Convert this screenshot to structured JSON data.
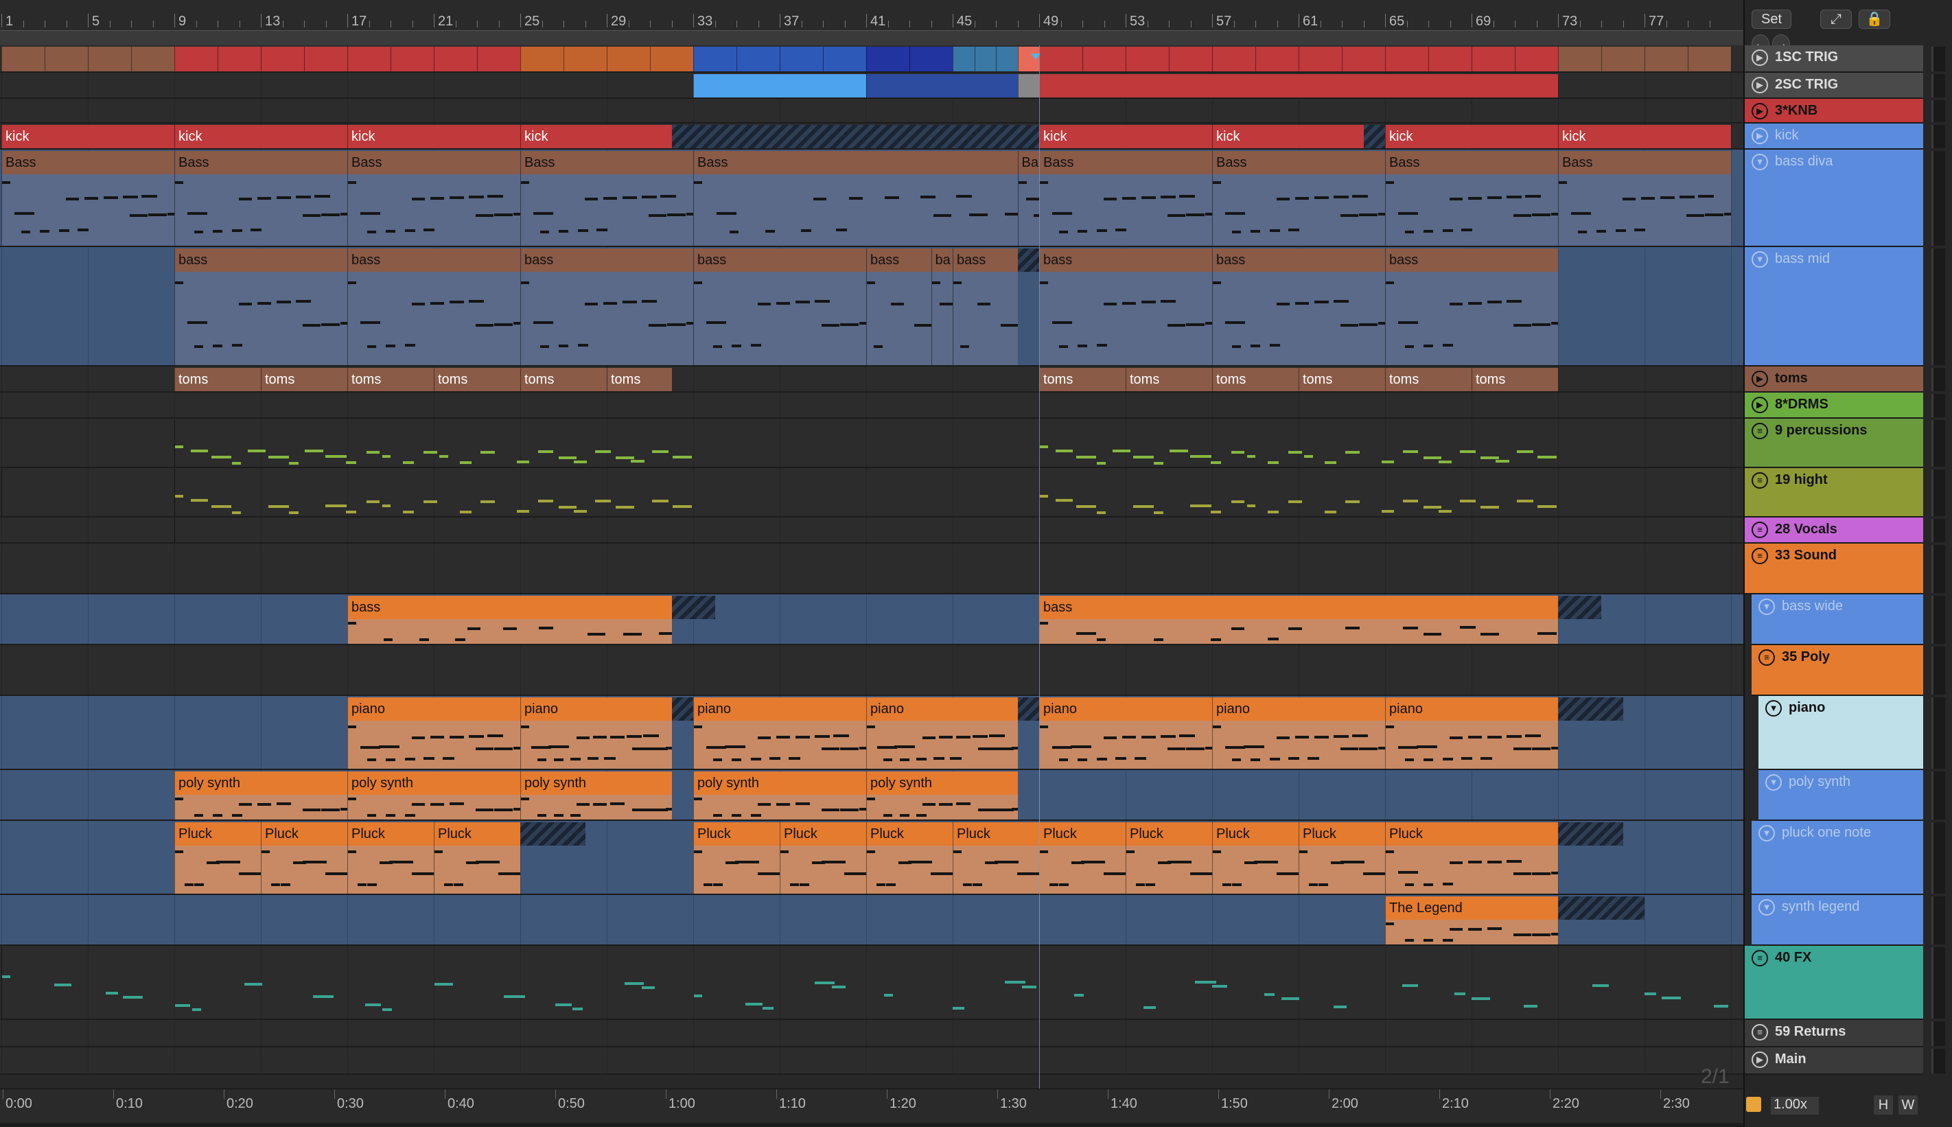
{
  "ruler": {
    "bars": [
      "1",
      "5",
      "9",
      "13",
      "17",
      "21",
      "25",
      "29",
      "33",
      "37",
      "41",
      "45",
      "49",
      "53",
      "57",
      "61",
      "65",
      "69",
      "73",
      "77"
    ]
  },
  "top_controls": {
    "set_label": "Set",
    "expand_icon": "expand-icon",
    "lock_icon": "lock-icon",
    "back_icon": "arrow-left-icon",
    "forward_icon": "arrow-right-icon"
  },
  "tracks": [
    {
      "name": "1SC TRIG",
      "color": "#4a4a4a",
      "icon": "play-icon"
    },
    {
      "name": "2SC TRIG",
      "color": "#4a4a4a",
      "icon": "play-icon"
    },
    {
      "name": "3*KNB",
      "color": "#c0393b",
      "icon": "play-icon"
    },
    {
      "name": "kick",
      "color": "#5b8bdc",
      "icon": "play-icon"
    },
    {
      "name": "bass diva",
      "color": "#5b8bdc",
      "icon": "chevron-down-icon"
    },
    {
      "name": "bass mid",
      "color": "#5b8bdc",
      "icon": "chevron-down-icon"
    },
    {
      "name": "toms",
      "color": "#8a5b47",
      "icon": "play-icon"
    },
    {
      "name": "8*DRMS",
      "color": "#6cad3f",
      "icon": "play-icon"
    },
    {
      "name": "9 percussions",
      "color": "#6a9a3c",
      "icon": "group-icon"
    },
    {
      "name": "19 hight",
      "color": "#8e9a33",
      "icon": "group-icon"
    },
    {
      "name": "28 Vocals",
      "color": "#c665d6",
      "icon": "group-icon"
    },
    {
      "name": "33 Sound",
      "color": "#e57b2f",
      "icon": "group-icon"
    },
    {
      "name": "bass wide",
      "color": "#5b8bdc",
      "icon": "chevron-down-icon"
    },
    {
      "name": "35 Poly",
      "color": "#e57b2f",
      "icon": "group-icon"
    },
    {
      "name": "piano",
      "color": "#bfe0e9",
      "icon": "chevron-down-icon"
    },
    {
      "name": "poly synth",
      "color": "#5b8bdc",
      "icon": "chevron-down-icon"
    },
    {
      "name": "pluck one note",
      "color": "#5b8bdc",
      "icon": "chevron-down-icon"
    },
    {
      "name": "synth legend",
      "color": "#5b8bdc",
      "icon": "chevron-down-icon"
    },
    {
      "name": "40 FX",
      "color": "#3aa693",
      "icon": "group-icon"
    },
    {
      "name": "59 Returns",
      "color": "#3a3a3a",
      "icon": "group-icon"
    },
    {
      "name": "Main",
      "color": "#3a3a3a",
      "icon": "play-icon"
    }
  ],
  "clip_names": {
    "kick": "kick",
    "bass_upper": "Bass",
    "bass_short": "Ba",
    "bass_lower": "bass",
    "bass_tiny": "ba",
    "toms": "toms",
    "bass_sound": "bass",
    "piano": "piano",
    "poly_synth": "poly synth",
    "pluck": "Pluck",
    "legend": "The Legend"
  },
  "timeline": {
    "labels": [
      "0:00",
      "0:10",
      "0:20",
      "0:30",
      "0:40",
      "0:50",
      "1:00",
      "1:10",
      "1:20",
      "1:30",
      "1:40",
      "1:50",
      "2:00",
      "2:10",
      "2:20",
      "2:30"
    ]
  },
  "footer": {
    "grid_label": "2/1",
    "zoom_value": "1.00x",
    "h_label": "H",
    "w_label": "W"
  },
  "colors": {
    "red": "#c0393b",
    "orange": "#e57b2f",
    "blue": "#5b8bdc",
    "green": "#6cad3f",
    "olive": "#8e9a33",
    "violet": "#c665d6",
    "teal": "#3aa693",
    "brown": "#8a5b47"
  }
}
